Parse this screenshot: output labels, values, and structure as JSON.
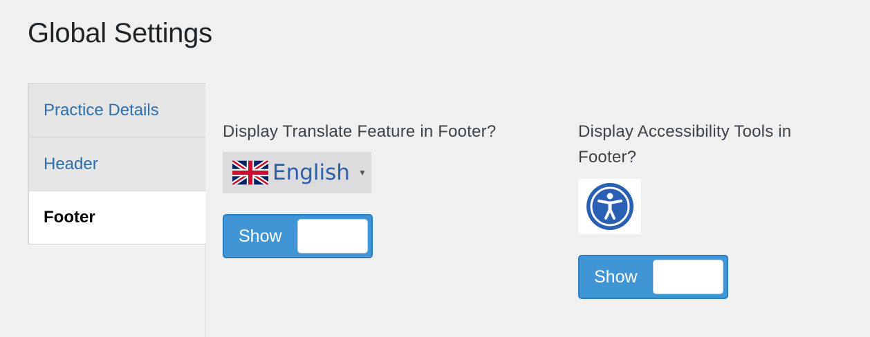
{
  "page": {
    "title": "Global Settings"
  },
  "tabs": [
    {
      "label": "Practice Details",
      "active": false
    },
    {
      "label": "Header",
      "active": false
    },
    {
      "label": "Footer",
      "active": true
    }
  ],
  "translate": {
    "label": "Display Translate Feature in Footer?",
    "language": "English",
    "flag_icon": "uk-flag-icon",
    "toggle_label": "Show"
  },
  "accessibility": {
    "label_line1": "Display Accessibility Tools in",
    "label_line2": "Footer?",
    "icon": "accessibility-icon",
    "icon_color": "#2a60b4",
    "toggle_label": "Show"
  },
  "colors": {
    "toggle_bg": "#4095d4",
    "tab_link": "#2c6fad"
  }
}
